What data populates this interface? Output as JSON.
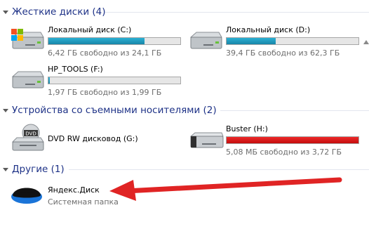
{
  "groups": {
    "hard_disks": "Жесткие диски (4)",
    "removable": "Устройства со съемными носителями (2)",
    "other": "Другие (1)"
  },
  "drives": [
    {
      "name": "Локальный диск (C:)",
      "free_text": "6,42 ГБ свободно из 24,1 ГБ",
      "used_fraction": 0.73
    },
    {
      "name": "Локальный диск (D:)",
      "free_text": "39,4 ГБ свободно из 62,3 ГБ",
      "used_fraction": 0.37
    },
    {
      "name": "HP_TOOLS (F:)",
      "free_text": "1,97 ГБ свободно из 1,99 ГБ",
      "used_fraction": 0.01
    }
  ],
  "removable": [
    {
      "name": "DVD RW дисковод (G:)",
      "icon_label": "DVD"
    },
    {
      "name": "Buster (H:)",
      "free_text": "5,08 МБ свободно из 3,72 ГБ",
      "used_fraction": 0.999
    }
  ],
  "other": [
    {
      "name": "Яндекс.Диск",
      "description": "Системная папка"
    }
  ],
  "colors": {
    "group_header": "#1e3287",
    "bar_normal": "#26a0c7",
    "bar_full": "#d61414",
    "annotation_arrow": "#e02424"
  }
}
